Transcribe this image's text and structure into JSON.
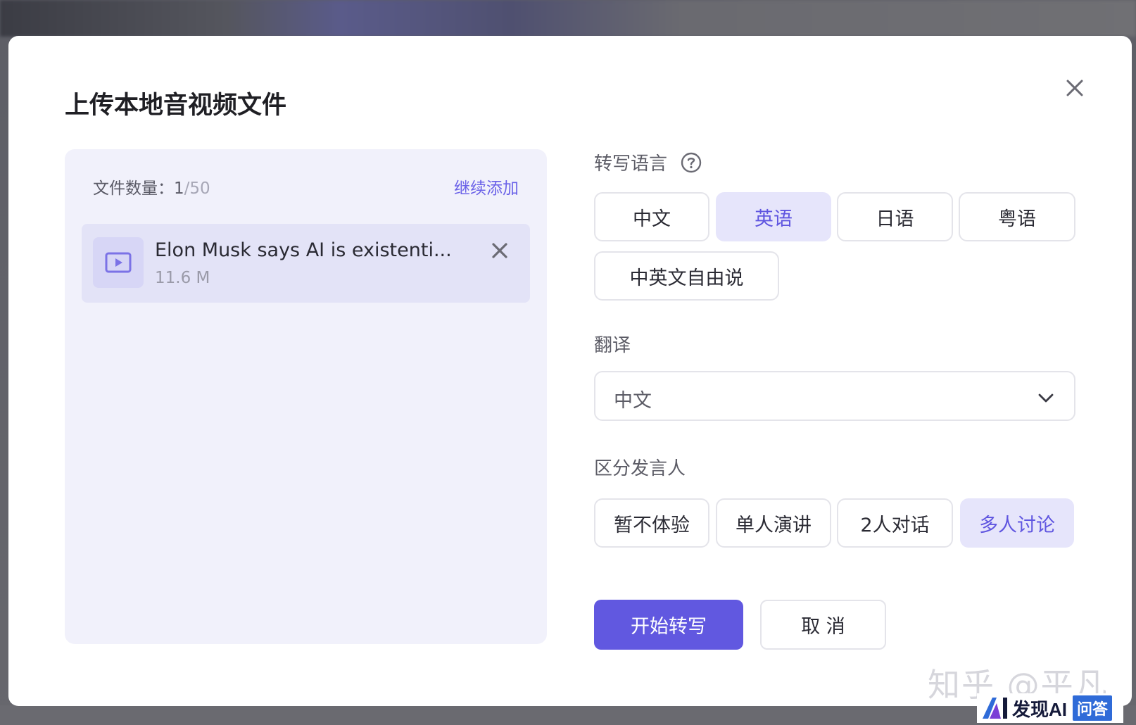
{
  "modal": {
    "title": "上传本地音视频文件"
  },
  "files": {
    "count_label": "文件数量：",
    "count_current": "1",
    "count_max": "/50",
    "add_more": "继续添加",
    "items": [
      {
        "name": "Elon Musk says AI is existenti...",
        "size": "11.6 M"
      }
    ]
  },
  "transcribe_language": {
    "label": "转写语言",
    "options": [
      "中文",
      "英语",
      "日语",
      "粤语",
      "中英文自由说"
    ],
    "selected": "英语"
  },
  "translation": {
    "label": "翻译",
    "value": "中文"
  },
  "speaker": {
    "label": "区分发言人",
    "options": [
      "暂不体验",
      "单人演讲",
      "2人对话",
      "多人讨论"
    ],
    "selected": "多人讨论"
  },
  "actions": {
    "start": "开始转写",
    "cancel": "取 消"
  },
  "watermarks": {
    "zhihu": "知乎 @平凡",
    "badge_text": "发现AI",
    "badge_tag": "问答"
  },
  "colors": {
    "accent": "#6158e0",
    "panel_bg": "#f1f1fb",
    "selected_bg": "#e6e5fb"
  }
}
